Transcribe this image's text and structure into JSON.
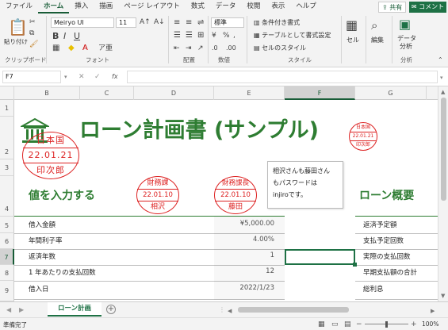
{
  "menu": {
    "tabs": [
      "ファイル",
      "ホーム",
      "挿入",
      "描画",
      "ページ レイアウト",
      "数式",
      "データ",
      "校閲",
      "表示",
      "ヘルプ"
    ],
    "active": "ホーム",
    "share": "共有",
    "comment": "コメント"
  },
  "ribbon": {
    "paste": "貼り付け",
    "font_name": "Meiryo UI",
    "font_size": "11",
    "number_format": "標準",
    "cond_format": "条件付き書式",
    "table_format": "テーブルとして書式設定",
    "cell_styles": "セルのスタイル",
    "cells": "セル",
    "editing": "編集",
    "data_analysis_1": "データ",
    "data_analysis_2": "分析",
    "groups": {
      "clipboard": "クリップボード",
      "font": "フォント",
      "alignment": "配置",
      "number": "数値",
      "styles": "スタイル",
      "analysis": "分析"
    }
  },
  "formula_bar": {
    "name_box": "F7",
    "fx": "fx",
    "value": ""
  },
  "columns": [
    "B",
    "C",
    "D",
    "E",
    "F",
    "G"
  ],
  "rows": [
    "1",
    "2",
    "3",
    "4",
    "5",
    "6",
    "7",
    "8",
    "9"
  ],
  "selected_col": "F",
  "selected_row": "7",
  "sheet": {
    "title": "ローン計画書 (サンプル)",
    "section_left": "値を入力する",
    "section_right": "ローン概要",
    "inputs": [
      {
        "label": "借入金額",
        "value": "¥5,000.00"
      },
      {
        "label": "年間利子率",
        "value": "4.00%"
      },
      {
        "label": "返済年数",
        "value": "1"
      },
      {
        "label": "1 年あたりの支払回数",
        "value": "12"
      },
      {
        "label": "借入日",
        "value": "2022/1/23"
      }
    ],
    "summary": [
      "返済予定額",
      "支払予定回数",
      "実際の支払回数",
      "早期支払額の合計",
      "総利息"
    ],
    "comment_lines": [
      "相沢さんも藤田さん",
      "もパスワードは",
      "injiroです。"
    ]
  },
  "stamps": [
    {
      "top": "日本国",
      "date": "22.01.21",
      "bottom": "印次郎"
    },
    {
      "top": "財務課",
      "date": "22.01.10",
      "bottom": "相沢"
    },
    {
      "top": "財務課長",
      "date": "22.01.10",
      "bottom": "藤田"
    },
    {
      "top": "日本国",
      "date": "22.01.21",
      "bottom": "印次郎"
    }
  ],
  "sheet_tabs": {
    "active": "ローン計画"
  },
  "status": {
    "ready": "準備完了",
    "zoom": "100%"
  },
  "colors": {
    "accent": "#1e7145",
    "title_green": "#2e7d32",
    "stamp_red": "#d22222"
  }
}
